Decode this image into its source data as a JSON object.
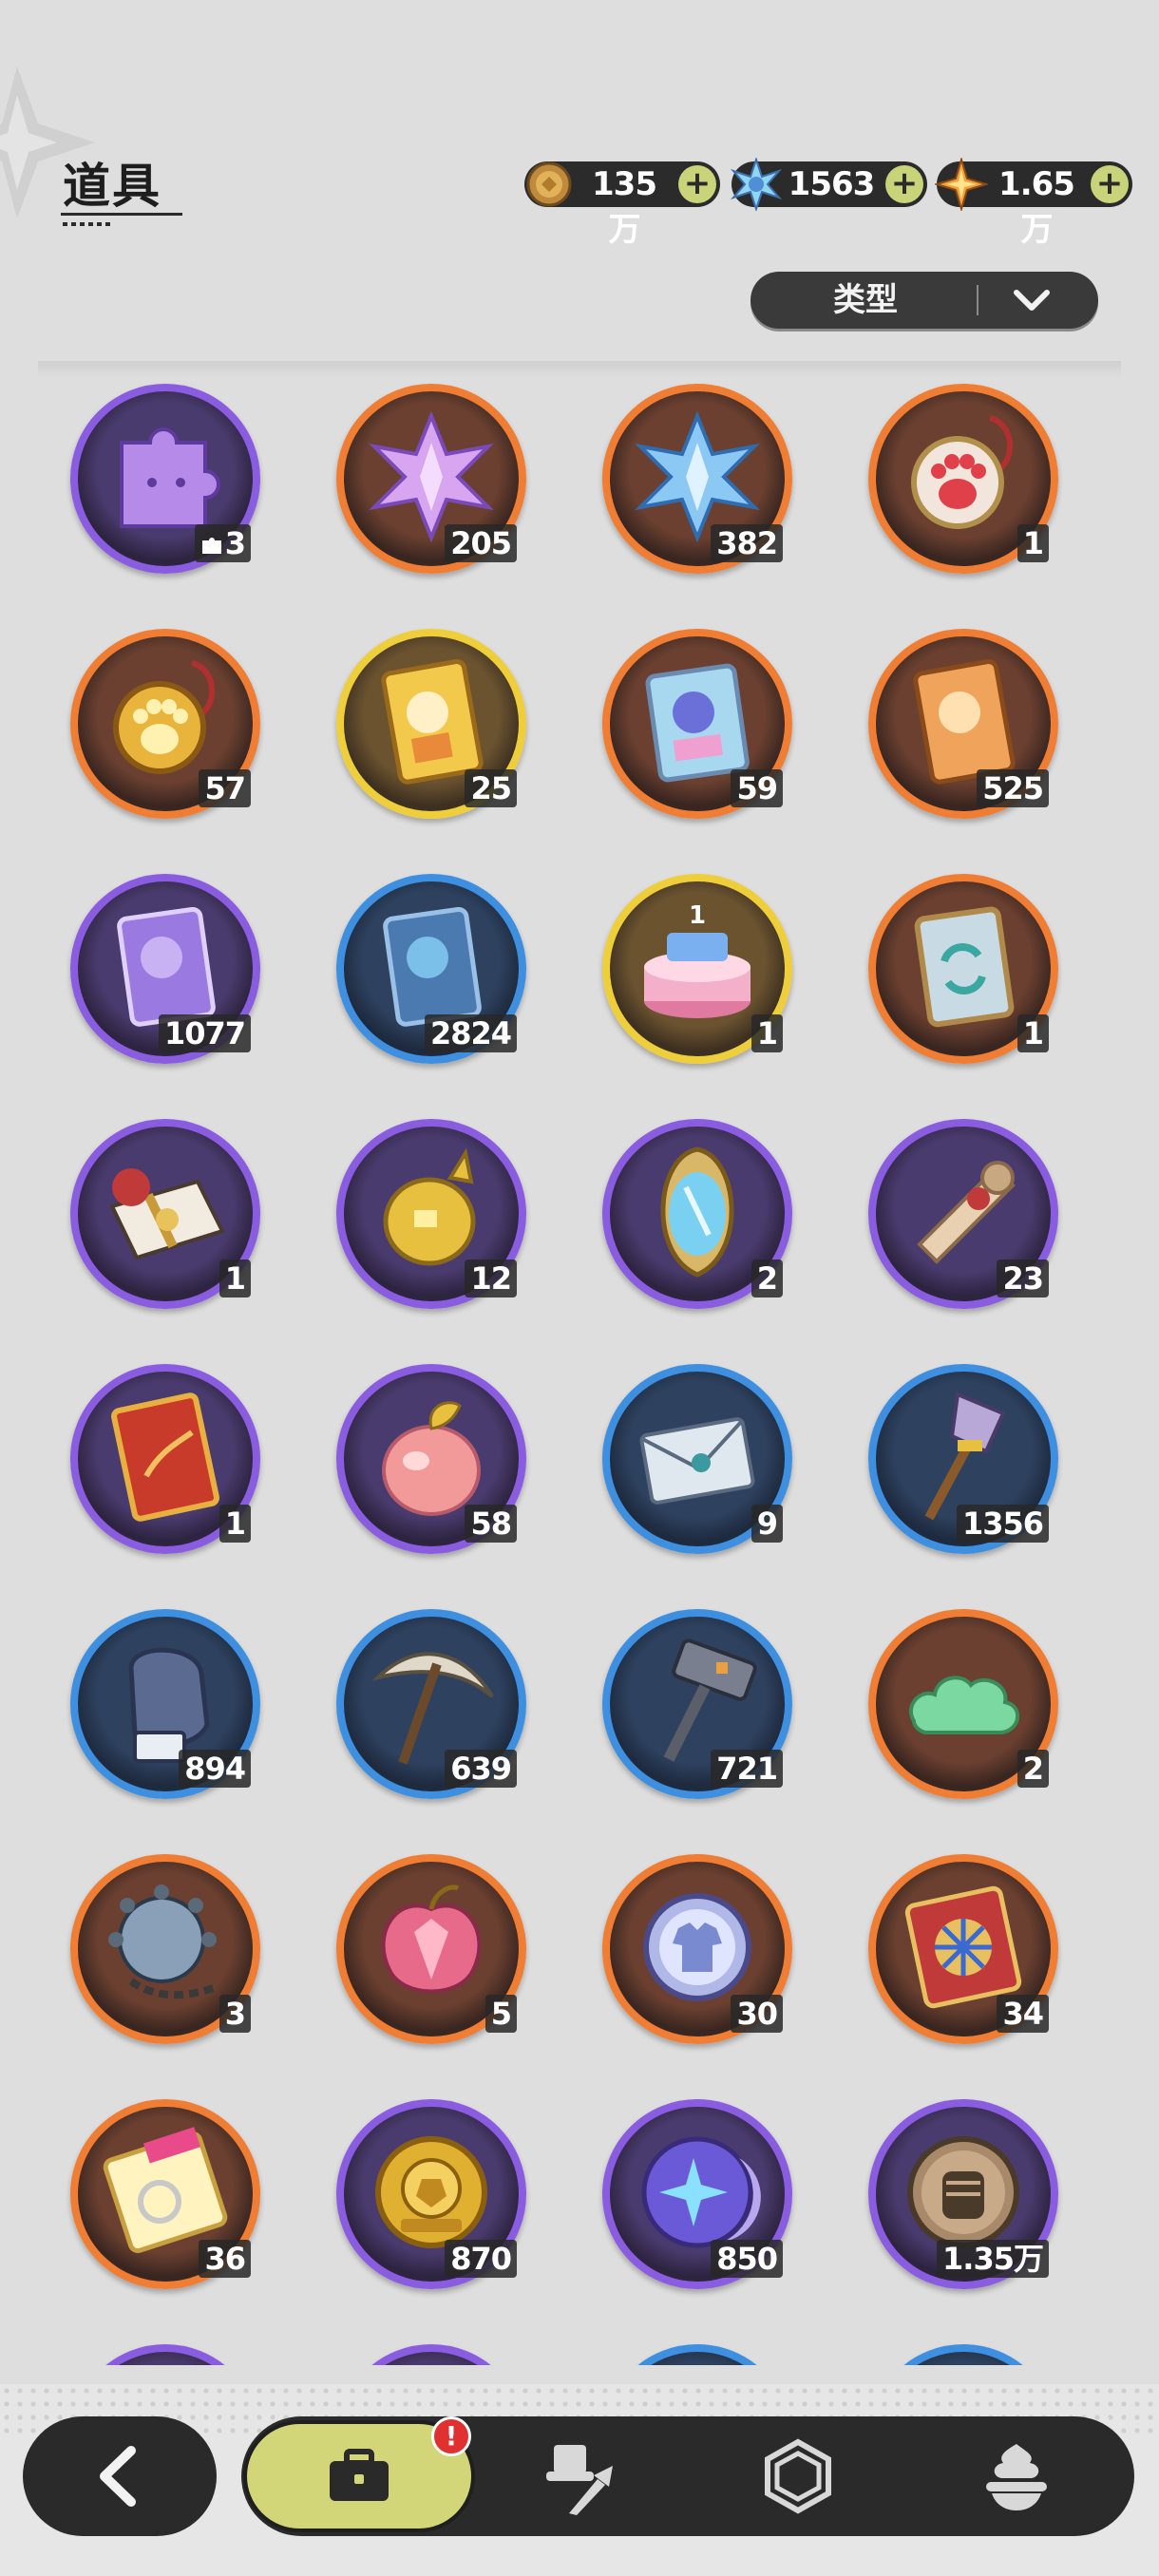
{
  "page": {
    "title": "道具"
  },
  "currencies": [
    {
      "id": "gold",
      "icon": "gold-coin-icon",
      "value": "135万"
    },
    {
      "id": "crystal",
      "icon": "crystal-star-icon",
      "value": "1563"
    },
    {
      "id": "star",
      "icon": "orange-star-icon",
      "value": "1.65万"
    }
  ],
  "filter": {
    "label": "类型"
  },
  "items": [
    {
      "name": "purple-cat-puzzle-item",
      "icon": "puzzle-icon",
      "rarity": "purple",
      "count": "3",
      "puzzle": true
    },
    {
      "name": "purple-star-crystal-item",
      "icon": "purple-crystal-icon",
      "rarity": "orange",
      "count": "205"
    },
    {
      "name": "blue-star-crystal-item",
      "icon": "blue-crystal-icon",
      "rarity": "orange",
      "count": "382"
    },
    {
      "name": "red-paw-charm-item",
      "icon": "red-paw-icon",
      "rarity": "orange",
      "count": "1"
    },
    {
      "name": "gold-paw-charm-item",
      "icon": "gold-paw-icon",
      "rarity": "orange",
      "count": "57"
    },
    {
      "name": "gold-card-item",
      "icon": "gold-card-icon",
      "rarity": "gold",
      "count": "25"
    },
    {
      "name": "holo-card-item",
      "icon": "holo-card-icon",
      "rarity": "orange",
      "count": "59"
    },
    {
      "name": "orange-card-item",
      "icon": "orange-card-icon",
      "rarity": "orange",
      "count": "525"
    },
    {
      "name": "purple-card-item",
      "icon": "purple-card-icon",
      "rarity": "purple",
      "count": "1077"
    },
    {
      "name": "blue-card-item",
      "icon": "blue-card-icon",
      "rarity": "blue",
      "count": "2824"
    },
    {
      "name": "birthday-cake-item",
      "icon": "cake-icon",
      "rarity": "gold",
      "count": "1"
    },
    {
      "name": "card-swap-item",
      "icon": "swap-card-icon",
      "rarity": "orange",
      "count": "1"
    },
    {
      "name": "gift-box-item",
      "icon": "gift-icon",
      "rarity": "purple",
      "count": "1"
    },
    {
      "name": "golden-egg-item",
      "icon": "golden-egg-icon",
      "rarity": "purple",
      "count": "12"
    },
    {
      "name": "magic-mirror-item",
      "icon": "mirror-icon",
      "rarity": "purple",
      "count": "2"
    },
    {
      "name": "scroll-item",
      "icon": "scroll-icon",
      "rarity": "purple",
      "count": "23"
    },
    {
      "name": "red-book-item",
      "icon": "book-icon",
      "rarity": "purple",
      "count": "1"
    },
    {
      "name": "peach-item",
      "icon": "peach-icon",
      "rarity": "purple",
      "count": "58"
    },
    {
      "name": "letter-item",
      "icon": "letter-icon",
      "rarity": "blue",
      "count": "9"
    },
    {
      "name": "shovel-item",
      "icon": "shovel-icon",
      "rarity": "blue",
      "count": "1356"
    },
    {
      "name": "glove-item",
      "icon": "glove-icon",
      "rarity": "blue",
      "count": "894"
    },
    {
      "name": "pickaxe-item",
      "icon": "pickaxe-icon",
      "rarity": "blue",
      "count": "639"
    },
    {
      "name": "hammer-item",
      "icon": "hammer-icon",
      "rarity": "blue",
      "count": "721"
    },
    {
      "name": "jade-cloud-item",
      "icon": "cloud-icon",
      "rarity": "orange",
      "count": "2"
    },
    {
      "name": "spiked-ball-item",
      "icon": "spiked-ball-icon",
      "rarity": "orange",
      "count": "3"
    },
    {
      "name": "crystal-apple-item",
      "icon": "crystal-apple-icon",
      "rarity": "orange",
      "count": "5"
    },
    {
      "name": "shirt-token-item",
      "icon": "shirt-token-icon",
      "rarity": "orange",
      "count": "30"
    },
    {
      "name": "wheel-ticket-item",
      "icon": "wheel-ticket-icon",
      "rarity": "orange",
      "count": "34"
    },
    {
      "name": "rainbow-ticket-item",
      "icon": "rainbow-ticket-icon",
      "rarity": "orange",
      "count": "36"
    },
    {
      "name": "gold-soccer-coin-item",
      "icon": "soccer-coin-icon",
      "rarity": "purple",
      "count": "870"
    },
    {
      "name": "star-moon-orb-item",
      "icon": "star-orb-icon",
      "rarity": "purple",
      "count": "850"
    },
    {
      "name": "fist-coin-item",
      "icon": "fist-coin-icon",
      "rarity": "purple",
      "count": "1.35万"
    }
  ],
  "partial_row": [
    "purple",
    "purple",
    "blue",
    "blue"
  ],
  "nav": {
    "badge": "!",
    "tabs": [
      {
        "name": "nav-tab-bag",
        "icon": "briefcase-icon",
        "active": true
      },
      {
        "name": "nav-tab-equipment",
        "icon": "hat-sword-icon",
        "active": false
      },
      {
        "name": "nav-tab-gems",
        "icon": "hexagon-gem-icon",
        "active": false
      },
      {
        "name": "nav-tab-food",
        "icon": "dessert-icon",
        "active": false
      }
    ]
  },
  "colors": {
    "purple": "#8a5ce0",
    "orange": "#ef7d34",
    "blue": "#3e8fe0",
    "gold": "#efce3c",
    "nav_active": "#d2d678",
    "badge": "#e03030"
  }
}
